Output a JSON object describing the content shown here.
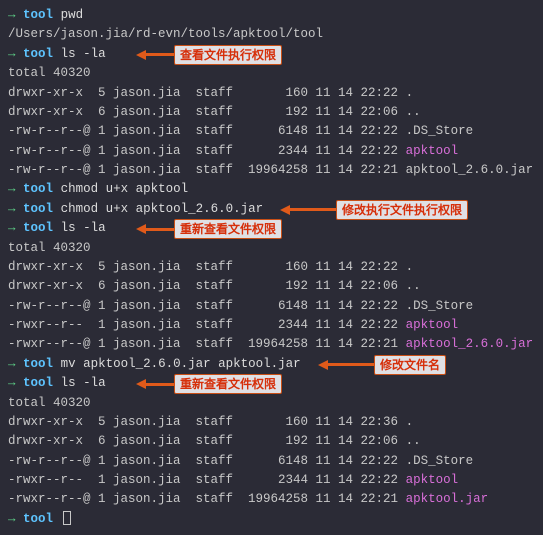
{
  "prompt_arrow": "→",
  "prompt_name": "tool",
  "cmd_pwd": "pwd",
  "pwd_output": "/Users/jason.jia/rd-evn/tools/apktool/tool",
  "cmd_ls": "ls -la",
  "total_line": "total 40320",
  "ls1": [
    "drwxr-xr-x  5 jason.jia  staff       160 11 14 22:22 .",
    "drwxr-xr-x  6 jason.jia  staff       192 11 14 22:06 ..",
    "-rw-r--r--@ 1 jason.jia  staff      6148 11 14 22:22 .DS_Store",
    "-rw-r--r--@ 1 jason.jia  staff      2344 11 14 22:22 "
  ],
  "ls1_highlight": "apktool",
  "ls1_last": "-rw-r--r--@ 1 jason.jia  staff  19964258 11 14 22:21 apktool_2.6.0.jar",
  "cmd_chmod1": "chmod u+x apktool",
  "cmd_chmod2": "chmod u+x apktool_2.6.0.jar",
  "ls2": [
    "drwxr-xr-x  5 jason.jia  staff       160 11 14 22:22 .",
    "drwxr-xr-x  6 jason.jia  staff       192 11 14 22:06 ..",
    "-rw-r--r--@ 1 jason.jia  staff      6148 11 14 22:22 .DS_Store",
    "-rwxr--r--  1 jason.jia  staff      2344 11 14 22:22 ",
    "-rwxr--r--@ 1 jason.jia  staff  19964258 11 14 22:21 "
  ],
  "ls2_h1": "apktool",
  "ls2_h2": "apktool_2.6.0.jar",
  "cmd_mv": "mv apktool_2.6.0.jar apktool.jar",
  "ls3": [
    "drwxr-xr-x  5 jason.jia  staff       160 11 14 22:36 .",
    "drwxr-xr-x  6 jason.jia  staff       192 11 14 22:06 ..",
    "-rw-r--r--@ 1 jason.jia  staff      6148 11 14 22:22 .DS_Store",
    "-rwxr--r--  1 jason.jia  staff      2344 11 14 22:22 ",
    "-rwxr--r--@ 1 jason.jia  staff  19964258 11 14 22:21 "
  ],
  "ls3_h1": "apktool",
  "ls3_h2": "apktool.jar",
  "callouts": {
    "c1": "查看文件执行权限",
    "c2": "修改执行文件执行权限",
    "c3": "重新查看文件权限",
    "c4": "修改文件名",
    "c5": "重新查看文件权限"
  }
}
